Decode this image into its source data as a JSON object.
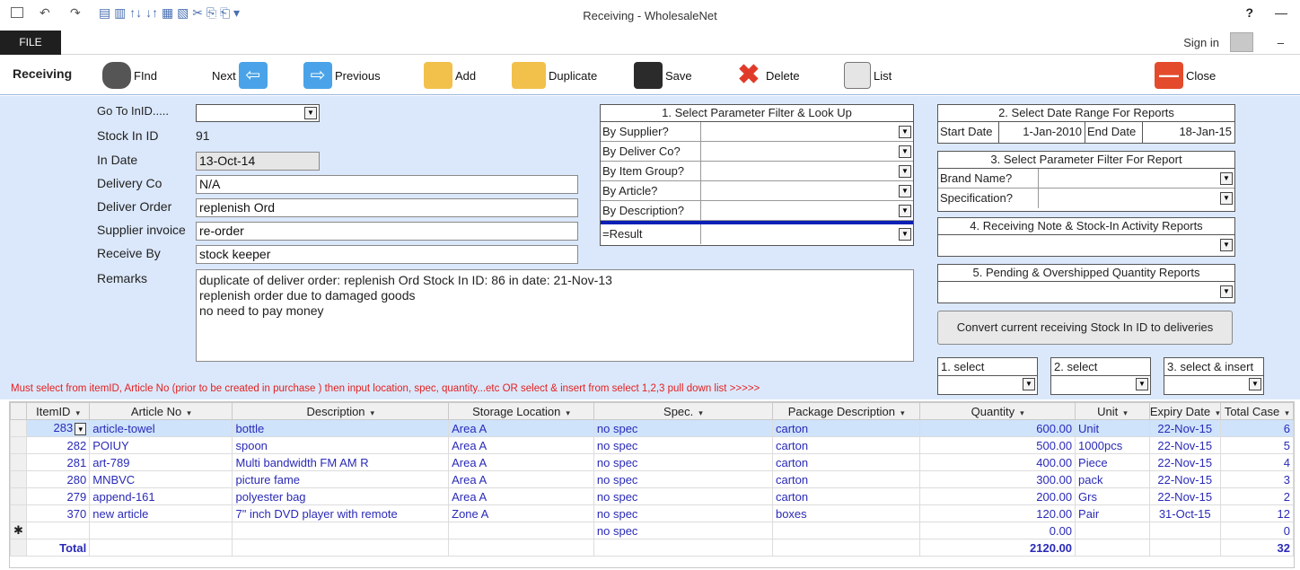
{
  "window": {
    "title": "Receiving - WholesaleNet",
    "help": "?",
    "minimize": "—",
    "file_tab": "FILE",
    "sign_in": "Sign in",
    "qa_minimize": "–"
  },
  "toolbar": {
    "form_name": "Receiving",
    "find": "FInd",
    "next": "Next",
    "previous": "Previous",
    "add": "Add",
    "duplicate": "Duplicate",
    "save": "Save",
    "delete": "Delete",
    "list": "List",
    "close": "Close"
  },
  "form": {
    "goto_label": "Go To InID.....",
    "goto_value": "",
    "stock_in_id_label": "Stock In ID",
    "stock_in_id_value": "91",
    "in_date_label": "In Date",
    "in_date_value": "13-Oct-14",
    "delivery_co_label": "Delivery Co",
    "delivery_co_value": "N/A",
    "deliver_order_label": "Deliver Order",
    "deliver_order_value": "replenish Ord",
    "supplier_invoice_label": "Supplier invoice",
    "supplier_invoice_value": "re-order",
    "receive_by_label": "Receive By",
    "receive_by_value": "stock keeper",
    "remarks_label": "Remarks",
    "remarks_lines": [
      "duplicate of deliver order: replenish Ord Stock In ID: 86  in date: 21-Nov-13",
      "replenish order due to damaged goods",
      "no need to pay money"
    ]
  },
  "filter_panel": {
    "title": "1. Select Parameter Filter & Look Up",
    "rows": [
      "By Supplier?",
      "By Deliver Co?",
      "By Item Group?",
      "By Article?",
      "By Description?"
    ],
    "result": "=Result"
  },
  "date_panel": {
    "title": "2. Select Date Range For  Reports",
    "start_label": "Start Date",
    "start_value": "1-Jan-2010",
    "end_label": "End Date",
    "end_value": "18-Jan-15"
  },
  "report_filter": {
    "title": "3. Select Parameter Filter For Report",
    "rows": [
      "Brand Name?",
      "Specification?"
    ]
  },
  "activity_reports": {
    "title": "4. Receiving Note & Stock-In Activity Reports"
  },
  "pending_reports": {
    "title": "5. Pending & Overshipped Quantity Reports"
  },
  "convert_button": "Convert current receiving Stock In ID to deliveries",
  "selects": [
    "1. select",
    "2. select",
    "3. select & insert"
  ],
  "warning": "Must select from itemID, Article No (prior to be created in purchase ) then input location, spec, quantity...etc OR select & insert from select 1,2,3 pull down list >>>>>",
  "grid": {
    "columns": [
      "ItemID",
      "Article No",
      "Description",
      "Storage Location",
      "Spec.",
      "Package Description",
      "Quantity",
      "Unit",
      "Expiry Date",
      "Total Case"
    ],
    "rows": [
      [
        "283",
        "article-towel",
        "bottle",
        "Area A",
        "no spec",
        "carton",
        "600.00",
        "Unit",
        "22-Nov-15",
        "6"
      ],
      [
        "282",
        "POIUY",
        "spoon",
        "Area A",
        "no spec",
        "carton",
        "500.00",
        "1000pcs",
        "22-Nov-15",
        "5"
      ],
      [
        "281",
        "art-789",
        "Multi bandwidth FM AM R",
        "Area A",
        "no spec",
        "carton",
        "400.00",
        "Piece",
        "22-Nov-15",
        "4"
      ],
      [
        "280",
        "MNBVC",
        "picture fame",
        "Area A",
        "no spec",
        "carton",
        "300.00",
        "pack",
        "22-Nov-15",
        "3"
      ],
      [
        "279",
        "append-161",
        "polyester bag",
        "Area A",
        "no spec",
        "carton",
        "200.00",
        "Grs",
        "22-Nov-15",
        "2"
      ],
      [
        "370",
        "new article",
        "7\" inch DVD player with remote",
        "Zone A",
        "no spec",
        "boxes",
        "120.00",
        "Pair",
        "31-Oct-15",
        "12"
      ],
      [
        "",
        "",
        "",
        "",
        "no spec",
        "",
        "0.00",
        "",
        "",
        "0"
      ]
    ],
    "new_row_marker": "✱",
    "total_label": "Total",
    "total_quantity": "2120.00",
    "total_cases": "32"
  }
}
